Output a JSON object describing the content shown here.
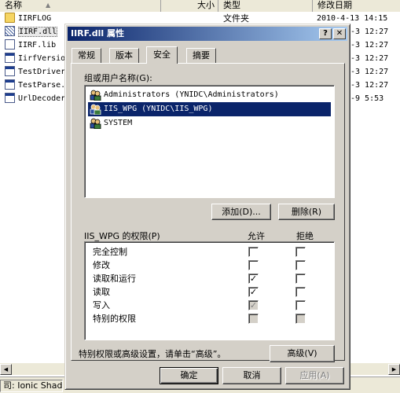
{
  "explorer": {
    "columns": {
      "name": "名称",
      "size": "大小",
      "type": "类型",
      "modified": "修改日期"
    },
    "files": [
      {
        "name": "IIRFLOG",
        "icon": "folder-icon",
        "type": "文件夹",
        "modified": "2010-4-13 14:15"
      },
      {
        "name": "IIRF.dll",
        "icon": "dll-file-icon",
        "modified": "-3 12:27"
      },
      {
        "name": "IIRF.lib",
        "icon": "lib-file-icon",
        "modified": "-3 12:27"
      },
      {
        "name": "IirfVersio",
        "icon": "exe-file-icon",
        "modified": "-3 12:27"
      },
      {
        "name": "TestDriver",
        "icon": "exe-file-icon",
        "modified": "-3 12:27"
      },
      {
        "name": "TestParse.",
        "icon": "exe-file-icon",
        "modified": "-3 12:27"
      },
      {
        "name": "UrlDecoder",
        "icon": "exe-file-icon",
        "modified": "-9 5:53"
      }
    ],
    "status_text": "司: Ionic Shad"
  },
  "dialog": {
    "title": "IIRF.dll 属性",
    "help_label": "?",
    "close_label": "✕",
    "tabs": [
      "常规",
      "版本",
      "安全",
      "摘要"
    ],
    "active_tab": "安全",
    "groups_label": "组或用户名称(G):",
    "users": [
      {
        "name": "Administrators (YNIDC\\Administrators)",
        "selected": false
      },
      {
        "name": "IIS_WPG (YNIDC\\IIS_WPG)",
        "selected": true
      },
      {
        "name": "SYSTEM",
        "selected": false
      }
    ],
    "add_button": "添加(D)...",
    "remove_button": "删除(R)",
    "permissions_label": "IIS_WPG 的权限(P)",
    "allow_header": "允许",
    "deny_header": "拒绝",
    "permissions": [
      {
        "name": "完全控制",
        "allow": false,
        "deny": false
      },
      {
        "name": "修改",
        "allow": false,
        "deny": false
      },
      {
        "name": "读取和运行",
        "allow": true,
        "deny": false
      },
      {
        "name": "读取",
        "allow": true,
        "deny": false
      },
      {
        "name": "写入",
        "allow": "inherited",
        "deny": false
      },
      {
        "name": "特别的权限",
        "allow": "disabled",
        "deny": "disabled"
      }
    ],
    "advanced_hint": "特别权限或高级设置，请单击“高级”。",
    "advanced_button": "高级(V)",
    "ok_button": "确定",
    "cancel_button": "取消",
    "apply_button": "应用(A)",
    "colors": {
      "titlebar_start": "#0a246a",
      "titlebar_end": "#a6caf0",
      "selection": "#0a246a",
      "face": "#d4d0c8"
    }
  }
}
